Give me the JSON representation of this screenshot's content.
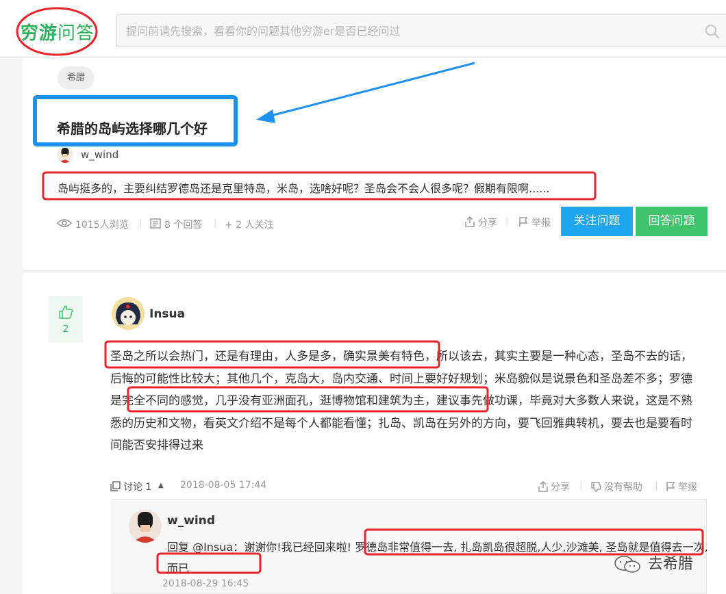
{
  "header": {
    "logo_part1": "穷游",
    "logo_part2": "问答",
    "search_placeholder": "提问前请先搜索，看看你的问题其他穷游er是否已经问过"
  },
  "question": {
    "tag": "希腊",
    "title": "希腊的岛屿选择哪几个好",
    "author": "w_wind",
    "body": "岛屿挺多的，主要纠结罗德岛还是克里特岛，米岛，选啥好呢？圣岛会不会人很多呢？假期有限啊......",
    "views": "1015人浏览",
    "answers": "8 个回答",
    "followers": "+ 2 人关注",
    "share": "分享",
    "report": "举报",
    "follow_button": "关注问题",
    "answer_button": "回答问题"
  },
  "answer": {
    "votes": "2",
    "author": "Insua",
    "body_seg1": "圣岛之所以会热门，还是有理由，人多是多，确实景美有特色，",
    "body_seg2": "所以该去，其实主要是一种心态，圣岛不去的话，后悔的可能性比较大；其他几个，克岛大，岛内交通、时间上要好好规划；米岛貌似是说景色和圣岛差不多；",
    "body_seg3": "罗德是完全不同的感觉，几乎没有亚洲面孔，逛博物馆和建筑为主，",
    "body_seg4": "建议事先做功课，毕竟对大多数人来说，这是不熟悉的历史和文物，看英文介绍不是每个人都能看懂；扎岛、凯岛在另外的方向，要飞回雅典转机，要去也是要看时间能否安排得过来",
    "discuss": "讨论 1",
    "date": "2018-08-05 17:44",
    "share": "分享",
    "not_helpful": "没有帮助",
    "report": "举报"
  },
  "reply": {
    "author": "w_wind",
    "body_seg1": "回复 @Insua：谢谢你!我已经回来啦! ",
    "body_seg2": "罗德岛非常值得一去, 扎岛凯岛很超脱,人少,沙滩美, 圣岛就是值得去一次,而已",
    "time": "2018-08-29 16:45"
  },
  "watermark": "去希腊",
  "colors": {
    "brand_green": "#2fae5a",
    "follow_blue": "#1fa6f0",
    "answer_green": "#3ec56b",
    "annotation_red": "#e8232a",
    "annotation_blue": "#1e90ef"
  }
}
